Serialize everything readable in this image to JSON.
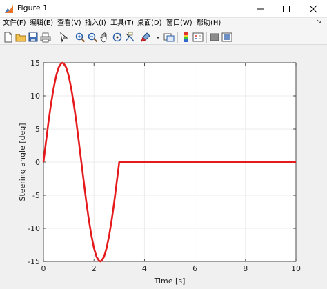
{
  "window": {
    "title": "Figure 1",
    "minimize_glyph": "—",
    "maximize_glyph": "☐",
    "close_glyph": "✕"
  },
  "menu": {
    "items": [
      "文件(F)",
      "编辑(E)",
      "查看(V)",
      "插入(I)",
      "工具(T)",
      "桌面(D)",
      "窗口(W)",
      "帮助(H)"
    ],
    "overflow_glyph": "↘"
  },
  "toolbar": {
    "icons": [
      "new-figure-icon",
      "open-file-icon",
      "save-icon",
      "print-icon",
      "edit-plot-arrow-icon",
      "zoom-in-icon",
      "zoom-out-icon",
      "pan-hand-icon",
      "rotate-3d-icon",
      "data-cursor-icon",
      "brush-icon",
      "link-plot-icon",
      "colorbar-icon",
      "legend-icon",
      "hide-plot-tools-icon",
      "show-plot-tools-icon"
    ]
  },
  "colors": {
    "line": "#e41a1c",
    "axes_background": "#ffffff",
    "grid": "#ebebeb"
  },
  "chart_data": {
    "type": "line",
    "xlabel": "Time [s]",
    "ylabel": "Steering angle [deg]",
    "xlim": [
      0,
      10
    ],
    "ylim": [
      -15,
      15
    ],
    "xticks": [
      0,
      2,
      4,
      6,
      8,
      10
    ],
    "yticks": [
      -15,
      -10,
      -5,
      0,
      5,
      10,
      15
    ],
    "grid": true,
    "series": [
      {
        "x": [
          0,
          0.1,
          0.2,
          0.3,
          0.4,
          0.5,
          0.6,
          0.7,
          0.75,
          0.8,
          0.9,
          1.0,
          1.1,
          1.2,
          1.3,
          1.4,
          1.5,
          1.6,
          1.7,
          1.8,
          1.9,
          2.0,
          2.1,
          2.2,
          2.25,
          2.3,
          2.4,
          2.5,
          2.6,
          2.7,
          2.8,
          2.9,
          3.0,
          10
        ],
        "y": [
          0,
          3.1,
          6.1,
          8.8,
          11.1,
          13.0,
          14.3,
          14.9,
          15.0,
          14.9,
          14.3,
          13.0,
          11.1,
          8.8,
          6.1,
          3.1,
          0,
          -3.1,
          -6.1,
          -8.8,
          -11.1,
          -13.0,
          -14.3,
          -14.9,
          -15.0,
          -14.9,
          -14.3,
          -13.0,
          -11.1,
          -8.8,
          -6.1,
          -3.1,
          0,
          0
        ]
      }
    ]
  }
}
